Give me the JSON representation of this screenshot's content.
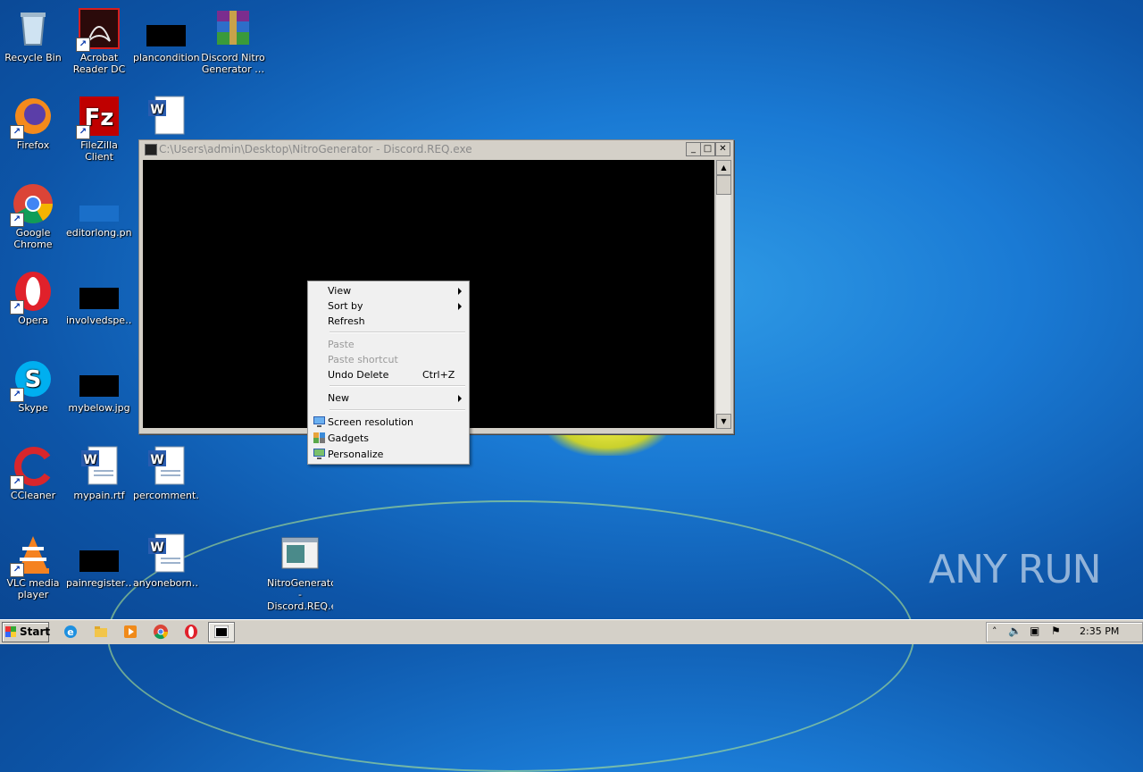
{
  "desktop": {
    "icons": [
      {
        "label": "Recycle Bin"
      },
      {
        "label": "Acrobat Reader DC"
      },
      {
        "label": "plancondition…"
      },
      {
        "label": "Discord Nitro Generator …"
      },
      {
        "label": "Firefox"
      },
      {
        "label": "FileZilla Client"
      },
      {
        "label": "Google Chrome"
      },
      {
        "label": "editorlong.png"
      },
      {
        "label": "Opera"
      },
      {
        "label": "involvedspe…"
      },
      {
        "label": "Skype"
      },
      {
        "label": "mybelow.jpg"
      },
      {
        "label": "CCleaner"
      },
      {
        "label": "mypain.rtf"
      },
      {
        "label": "percomment…"
      },
      {
        "label": "VLC media player"
      },
      {
        "label": "painregister…"
      },
      {
        "label": "anyoneborn…"
      },
      {
        "label": "NitroGenerator - Discord.REQ.exe"
      }
    ]
  },
  "console_window": {
    "title": "C:\\Users\\admin\\Desktop\\NitroGenerator - Discord.REQ.exe"
  },
  "context_menu": {
    "view": "View",
    "sort_by": "Sort by",
    "refresh": "Refresh",
    "paste": "Paste",
    "paste_shortcut": "Paste shortcut",
    "undo_delete": "Undo Delete",
    "undo_shortcut": "Ctrl+Z",
    "new": "New",
    "screen_resolution": "Screen resolution",
    "gadgets": "Gadgets",
    "personalize": "Personalize"
  },
  "taskbar": {
    "start_label": "Start",
    "clock": "2:35 PM"
  },
  "watermark": "ANY RUN"
}
